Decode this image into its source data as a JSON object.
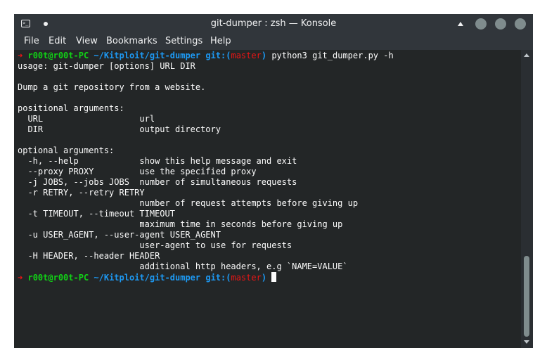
{
  "window": {
    "title": "git-dumper : zsh — Konsole",
    "app_icon_text": ">_",
    "icons": [
      "terminal-app-icon",
      "pin-dot-icon",
      "keep-above-icon",
      "minimize-icon",
      "maximize-icon",
      "close-icon"
    ]
  },
  "menu": {
    "items": [
      "File",
      "Edit",
      "View",
      "Bookmarks",
      "Settings",
      "Help"
    ]
  },
  "prompt": {
    "arrow": "➜",
    "user_host": "r00t@r00t-PC",
    "path": "~/Kitploit/git-dumper",
    "git_open": "git:(",
    "branch": "master",
    "git_close": ")"
  },
  "command": "python3 git_dumper.py -h",
  "output": [
    "usage: git-dumper [options] URL DIR",
    "",
    "Dump a git repository from a website.",
    "",
    "positional arguments:",
    "  URL                   url",
    "  DIR                   output directory",
    "",
    "optional arguments:",
    "  -h, --help            show this help message and exit",
    "  --proxy PROXY         use the specified proxy",
    "  -j JOBS, --jobs JOBS  number of simultaneous requests",
    "  -r RETRY, --retry RETRY",
    "                        number of request attempts before giving up",
    "  -t TIMEOUT, --timeout TIMEOUT",
    "                        maximum time in seconds before giving up",
    "  -u USER_AGENT, --user-agent USER_AGENT",
    "                        user-agent to use for requests",
    "  -H HEADER, --header HEADER",
    "                        additional http headers, e.g `NAME=VALUE`"
  ],
  "colors": {
    "background": "#232627",
    "foreground": "#fcfcfc",
    "prompt_arrow": "#ed1515",
    "user_host": "#11d116",
    "path": "#1d99f3",
    "branch": "#ed1515",
    "titlebar": "#31363b"
  }
}
